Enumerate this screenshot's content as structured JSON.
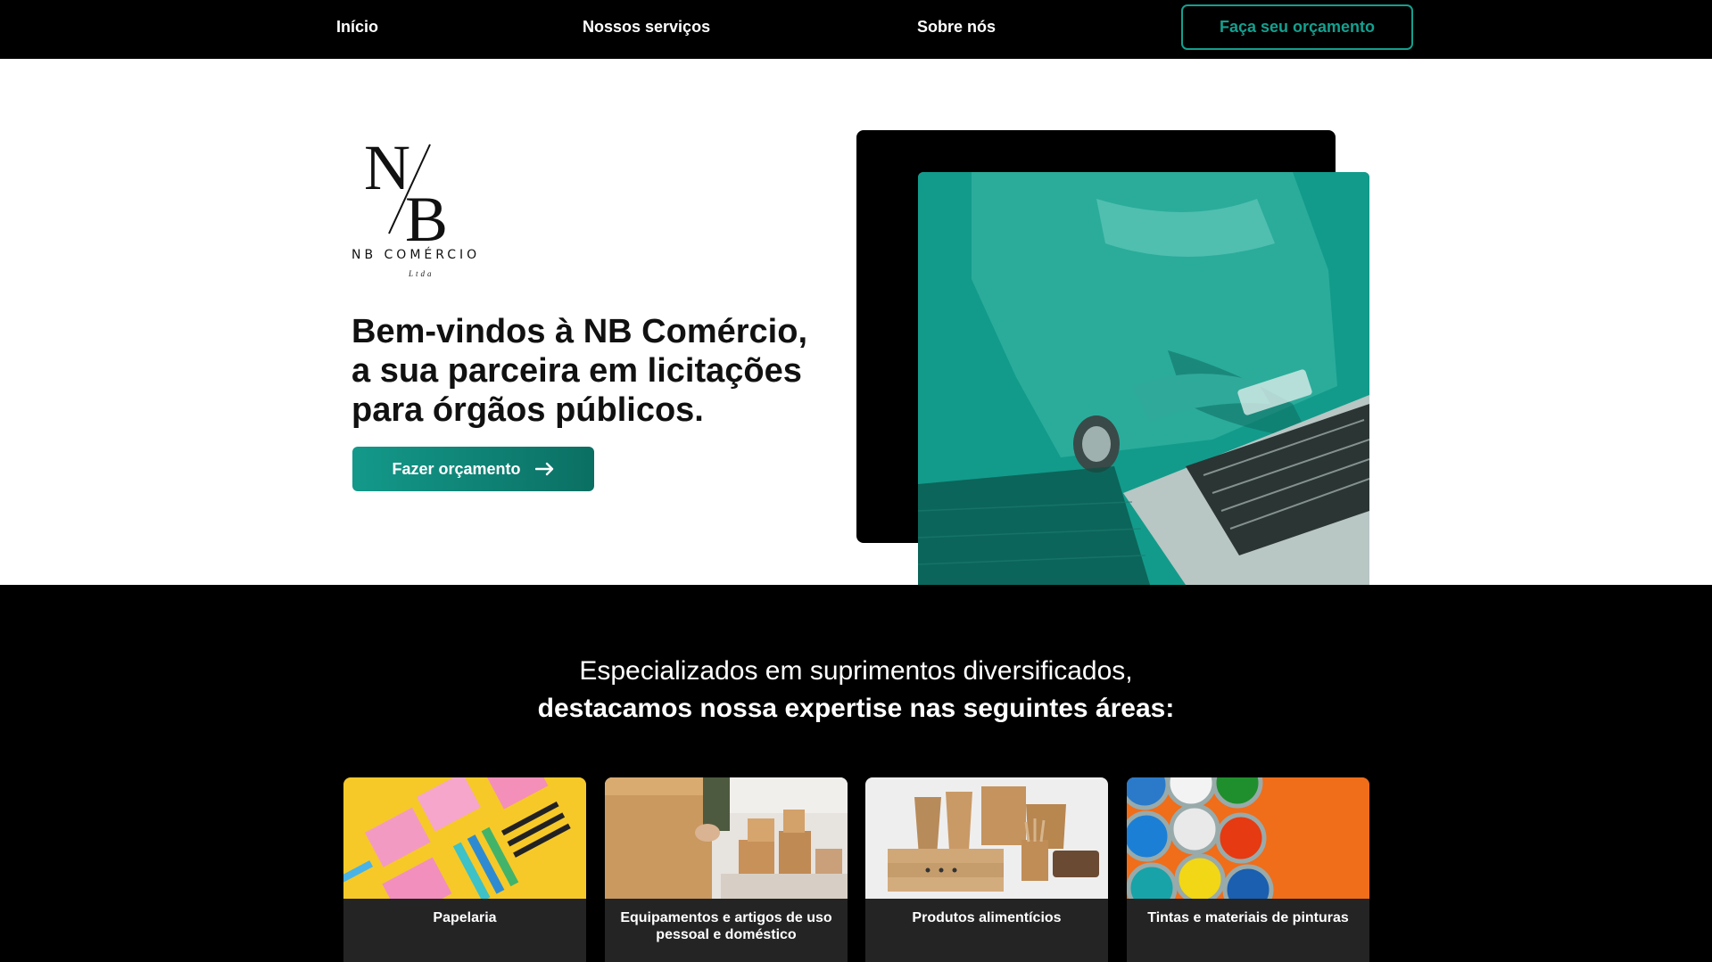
{
  "nav": {
    "items": [
      {
        "label": "Início"
      },
      {
        "label": "Nossos serviços"
      },
      {
        "label": "Sobre nós"
      }
    ],
    "cta_label": "Faça seu orçamento"
  },
  "hero": {
    "logo": {
      "monogram_n": "N",
      "monogram_b": "B",
      "brand": "NB COMÉRCIO",
      "sub": "Ltda"
    },
    "headline_lines": [
      "Bem-vindos à NB Comércio,",
      "a sua parceira em licitações",
      "para órgãos públicos."
    ],
    "button_label": "Fazer orçamento",
    "button_icon": "arrow-right-icon",
    "image_icon": "person-with-laptop-and-card"
  },
  "areas": {
    "title_line1": "Especializados em suprimentos diversificados,",
    "title_line2": "destacamos nossa expertise nas seguintes áreas:",
    "cards": [
      {
        "label": "Papelaria",
        "image": "stationery-flatlay"
      },
      {
        "label": "Equipamentos e artigos de uso pessoal e doméstico",
        "image": "moving-boxes"
      },
      {
        "label": "Produtos alimentícios",
        "image": "food-packaging"
      },
      {
        "label": "Tintas e materiais de pinturas",
        "image": "paint-cans"
      }
    ]
  },
  "colors": {
    "accent": "#14a08f",
    "dark": "#000000",
    "card_bg": "#242424"
  }
}
